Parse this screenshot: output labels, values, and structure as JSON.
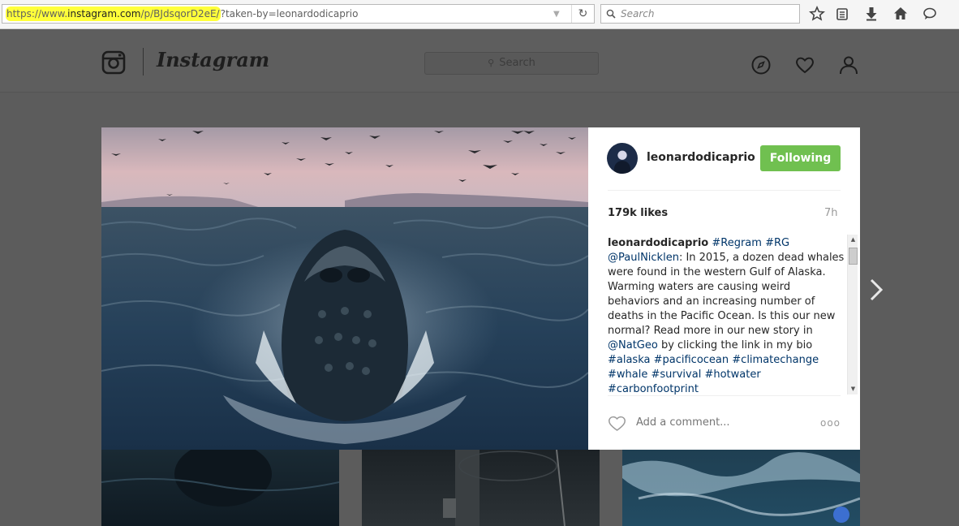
{
  "browser": {
    "url_highlighted_prefix": "https://www.",
    "url_domain": "instagram.com",
    "url_path_highlighted": "/p/BJdsqorD2eE/",
    "url_rest": "?taken-by=leonardodicaprio",
    "search_placeholder": "Search",
    "toolbar_icons": [
      "bookmark-star-icon",
      "reading-list-icon",
      "download-icon",
      "home-icon",
      "chat-icon"
    ]
  },
  "header": {
    "wordmark": "Instagram",
    "search_placeholder": "Search",
    "icons": [
      "explore-compass-icon",
      "activity-heart-icon",
      "profile-icon"
    ]
  },
  "post": {
    "username": "leonardodicaprio",
    "follow_label": "Following",
    "likes": "179k likes",
    "time": "7h",
    "caption": {
      "author": "leonardodicaprio",
      "text_parts": [
        {
          "type": "tag",
          "text": "#Regram"
        },
        {
          "type": "tag",
          "text": "#RG"
        },
        {
          "type": "tag",
          "text": "@PaulNicklen"
        },
        {
          "type": "text",
          "text": ": In 2015, a dozen dead whales were found in the western Gulf of Alaska. Warming waters are causing weird behaviors and an increasing number of deaths in the Pacific Ocean. Is this our new normal? Read more in our new story in "
        },
        {
          "type": "tag",
          "text": "@NatGeo"
        },
        {
          "type": "text",
          "text": " by clicking the link in my bio "
        },
        {
          "type": "tag",
          "text": "#alaska"
        },
        {
          "type": "tag",
          "text": "#pacificocean"
        },
        {
          "type": "tag",
          "text": "#climatechange"
        },
        {
          "type": "tag",
          "text": "#whale"
        },
        {
          "type": "tag",
          "text": "#survival"
        },
        {
          "type": "tag",
          "text": "#hotwater"
        },
        {
          "type": "tag",
          "text": "#carbonfootprint"
        }
      ]
    },
    "comment_placeholder": "Add a comment...",
    "more_label": "ooo"
  },
  "colors": {
    "follow_button": "#70c050",
    "tag_link": "#003569",
    "url_highlight": "#ffff3a"
  }
}
